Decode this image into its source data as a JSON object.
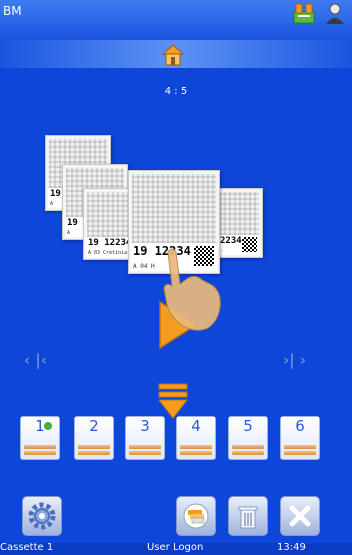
{
  "app": {
    "title": "BM"
  },
  "screen": {
    "counter": "4 : 5"
  },
  "cassettes": [
    {
      "id_text": "19 1",
      "small_text": "A"
    },
    {
      "id_text": "19 1",
      "small_text": "A"
    },
    {
      "id_text": "19 12234",
      "small_text": "A  03  Cretinia"
    },
    {
      "id_text": "19 12234",
      "small_text": "A  04  H"
    },
    {
      "id_text": "2234",
      "small_text": "-"
    }
  ],
  "navigation": {
    "first": "‹ |‹",
    "last": "›| ›"
  },
  "slots": [
    {
      "label": "1",
      "checked": true
    },
    {
      "label": "2",
      "checked": false
    },
    {
      "label": "3",
      "checked": false
    },
    {
      "label": "4",
      "checked": false
    },
    {
      "label": "5",
      "checked": false
    },
    {
      "label": "6",
      "checked": false
    }
  ],
  "status": {
    "cassette": "Cassette 1",
    "user": "User Logon",
    "time": "13:49"
  },
  "colors": {
    "background": "#0d46d8",
    "accent_orange": "#f39c1f",
    "topbar": "#2a66ea"
  },
  "icons": [
    "printer-status-icon",
    "person-icon",
    "home-icon",
    "play-icon",
    "hand-icon",
    "download-arrow-icon",
    "settings-gear-icon",
    "stack-print-icon",
    "trash-icon",
    "close-icon"
  ]
}
